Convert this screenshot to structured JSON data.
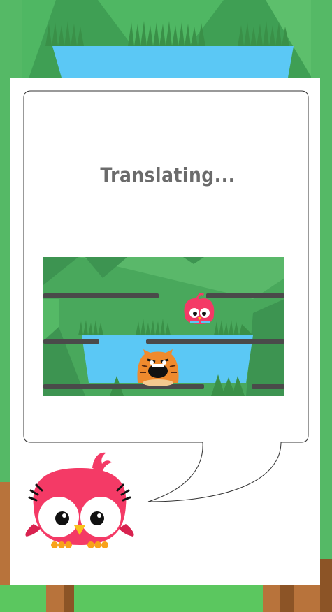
{
  "dialog": {
    "status_text": "Translating..."
  },
  "colors": {
    "grass": "#5bc75f",
    "forest": "#3f9f54",
    "water": "#5bc8f5",
    "dirt": "#b8733b",
    "bird": "#f43a66",
    "cat": "#ef8a2d",
    "platform": "#4a4a4a"
  },
  "characters": {
    "narrator": "pink-bird-icon",
    "preview_bird": "pink-bird-icon",
    "preview_cat": "angry-cat-icon"
  }
}
